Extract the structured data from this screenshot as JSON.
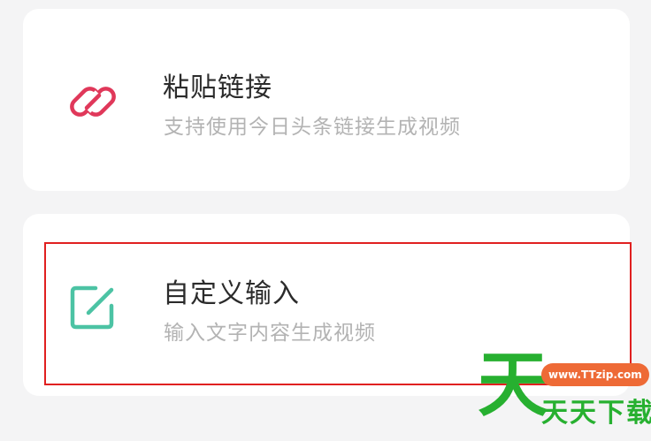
{
  "options": [
    {
      "title": "粘贴链接",
      "subtitle": "支持使用今日头条链接生成视频",
      "icon": "link-icon",
      "icon_color": "#e0385a"
    },
    {
      "title": "自定义输入",
      "subtitle": "输入文字内容生成视频",
      "icon": "edit-icon",
      "icon_color": "#4cc3a4"
    }
  ],
  "watermark": {
    "logo_char": "天",
    "url": "www.TTzip.com",
    "text": "天天下载"
  }
}
